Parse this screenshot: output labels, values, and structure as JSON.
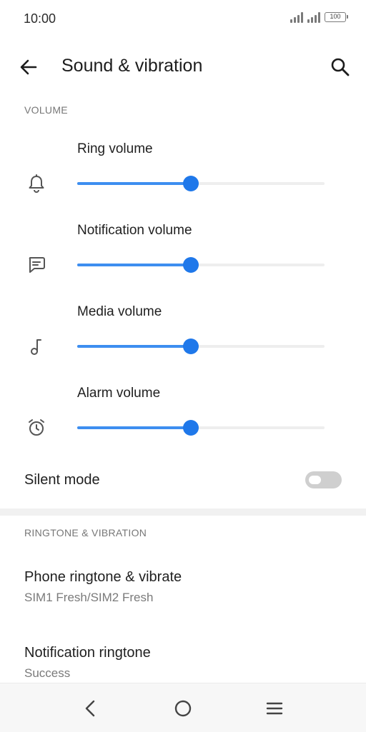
{
  "status": {
    "time": "10:00",
    "battery": "100"
  },
  "appbar": {
    "title": "Sound & vibration"
  },
  "volume_section": {
    "header": "VOLUME",
    "items": [
      {
        "label": "Ring volume",
        "icon": "bell-icon",
        "level_percent": 46
      },
      {
        "label": "Notification volume",
        "icon": "message-icon",
        "level_percent": 46
      },
      {
        "label": "Media volume",
        "icon": "music-note-icon",
        "level_percent": 46
      },
      {
        "label": "Alarm volume",
        "icon": "alarm-clock-icon",
        "level_percent": 46
      }
    ]
  },
  "silent_mode": {
    "label": "Silent mode",
    "enabled": false
  },
  "ringtone_section": {
    "header": "RINGTONE & VIBRATION",
    "items": [
      {
        "title": "Phone ringtone & vibrate",
        "subtitle": "SIM1 Fresh/SIM2 Fresh"
      },
      {
        "title": "Notification ringtone",
        "subtitle": "Success"
      }
    ]
  },
  "colors": {
    "accent": "#1f78ea",
    "track": "#eeeeee",
    "toggle_off": "#cfcfcf"
  }
}
